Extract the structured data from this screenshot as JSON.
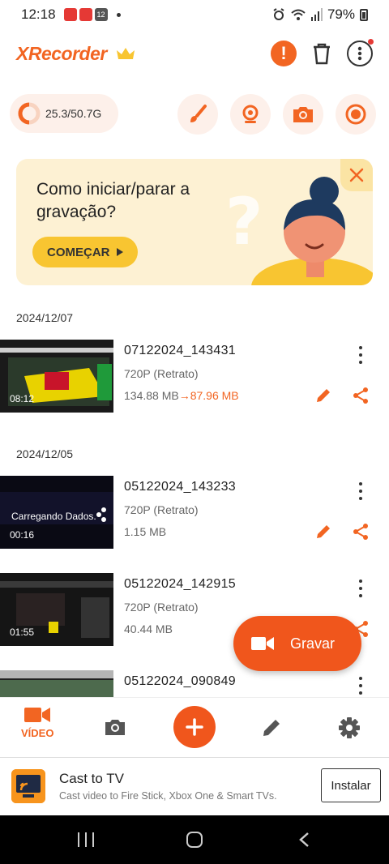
{
  "status_bar": {
    "time": "12:18",
    "day_badge": "12",
    "battery": "79%"
  },
  "header": {
    "app_name": "XRecorder",
    "alert_glyph": "!",
    "icons": [
      "crown-icon",
      "alert-icon",
      "trash-icon",
      "more-icon"
    ]
  },
  "quick": {
    "storage": "25.3/50.7G",
    "storage_fraction": 0.5,
    "actions": [
      "brush-icon",
      "facecam-icon",
      "screenshot-icon",
      "record-dot-icon"
    ]
  },
  "banner": {
    "title": "Como iniciar/parar a gravação?",
    "cta": "COMEÇAR"
  },
  "groups": [
    {
      "date": "2024/12/07",
      "items": [
        {
          "name": "07122024_143431",
          "resolution": "720P (Retrato)",
          "size": "134.88 MB",
          "arrow": "→",
          "new_size": "87.96 MB",
          "duration": "08:12",
          "overlay": ""
        }
      ]
    },
    {
      "date": "2024/12/05",
      "items": [
        {
          "name": "05122024_143233",
          "resolution": "720P (Retrato)",
          "size": "1.15 MB",
          "arrow": "",
          "new_size": "",
          "duration": "00:16",
          "overlay": "Carregando Dados."
        },
        {
          "name": "05122024_142915",
          "resolution": "720P (Retrato)",
          "size": "40.44 MB",
          "arrow": "",
          "new_size": "",
          "duration": "01:55",
          "overlay": ""
        },
        {
          "name": "05122024_090849",
          "resolution": "",
          "size": "",
          "arrow": "",
          "new_size": "",
          "duration": "",
          "overlay": ""
        }
      ]
    }
  ],
  "fab": {
    "label": "Gravar"
  },
  "bottom_nav": {
    "video_label": "VÍDEO"
  },
  "ad": {
    "title": "Cast to TV",
    "subtitle": "Cast video to Fire Stick, Xbox One & Smart TVs.",
    "button": "Instalar"
  },
  "colors": {
    "accent": "#f26522",
    "banner_bg": "#fdf1d3",
    "chip_bg": "#fdf0ea",
    "cta": "#f8c531"
  }
}
